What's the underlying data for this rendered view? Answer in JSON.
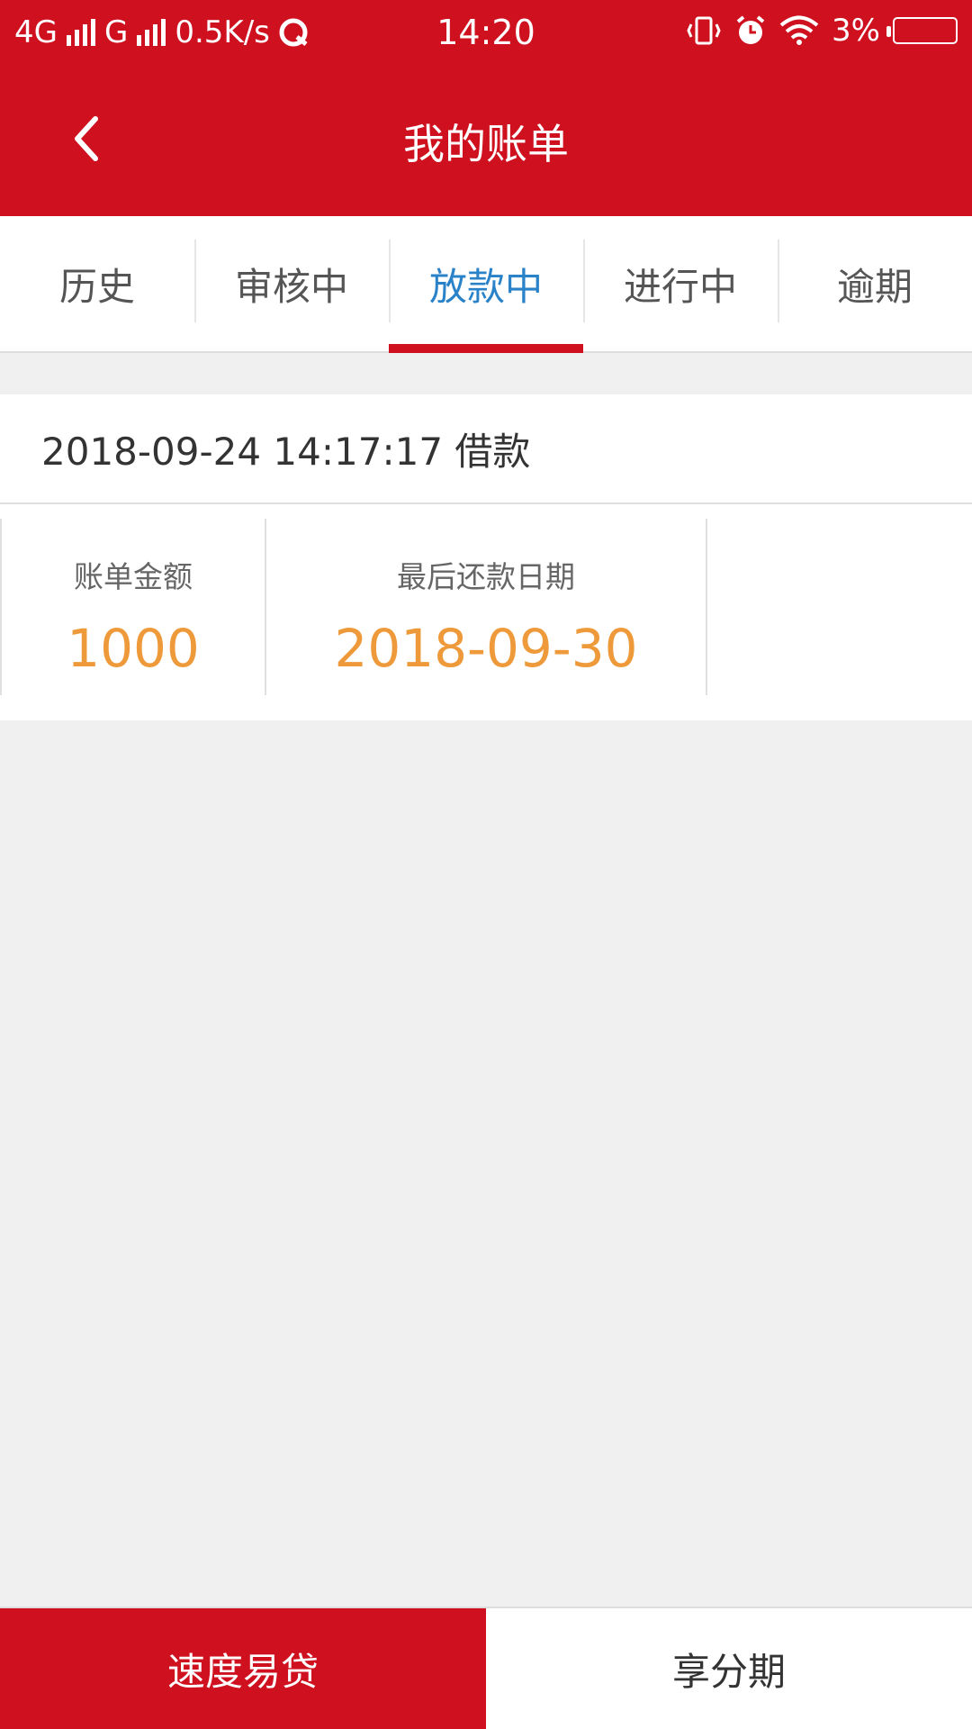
{
  "status_bar": {
    "network1": "4G",
    "network2": "G",
    "speed": "0.5K/s",
    "time": "14:20",
    "battery": "3%"
  },
  "header": {
    "title": "我的账单"
  },
  "tabs": [
    {
      "label": "历史"
    },
    {
      "label": "审核中"
    },
    {
      "label": "放款中"
    },
    {
      "label": "进行中"
    },
    {
      "label": "逾期"
    }
  ],
  "active_tab": "放款中",
  "bill": {
    "title": "2018-09-24 14:17:17 借款",
    "amount_label": "账单金额",
    "amount": "1000",
    "due_label": "最后还款日期",
    "due_date": "2018-09-30"
  },
  "bottom_tabs": [
    {
      "label": "速度易贷"
    },
    {
      "label": "享分期"
    }
  ],
  "colors": {
    "brand_red": "#cf101f",
    "active_tab_text": "#2a82c9",
    "value_orange": "#ee9a3a"
  },
  "icons": [
    "back-arrow-icon",
    "signal-icon",
    "cloud-sync-icon",
    "vibrate-icon",
    "alarm-icon",
    "wifi-icon",
    "battery-icon"
  ]
}
